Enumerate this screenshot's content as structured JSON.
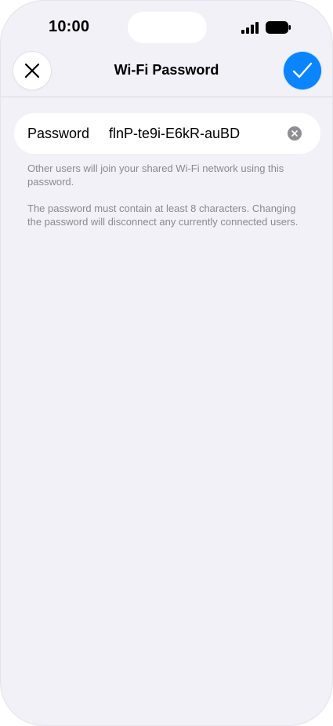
{
  "status_bar": {
    "time": "10:00"
  },
  "icons": {
    "signal": "cellular-signal-icon",
    "battery": "battery-icon",
    "close": "close-icon",
    "done": "checkmark-icon",
    "clear": "clear-text-icon"
  },
  "colors": {
    "accent": "#0a84ff",
    "background": "#f2f1f7",
    "card": "#ffffff",
    "secondary_text": "#8a8a8e"
  },
  "nav": {
    "title": "Wi-Fi Password"
  },
  "password_field": {
    "label": "Password",
    "value": "flnP-te9i-E6kR-auBD"
  },
  "footnotes": [
    "Other users will join your shared Wi-Fi network using this password.",
    "The password must contain at least 8 characters. Changing the password will disconnect any currently connected users."
  ]
}
